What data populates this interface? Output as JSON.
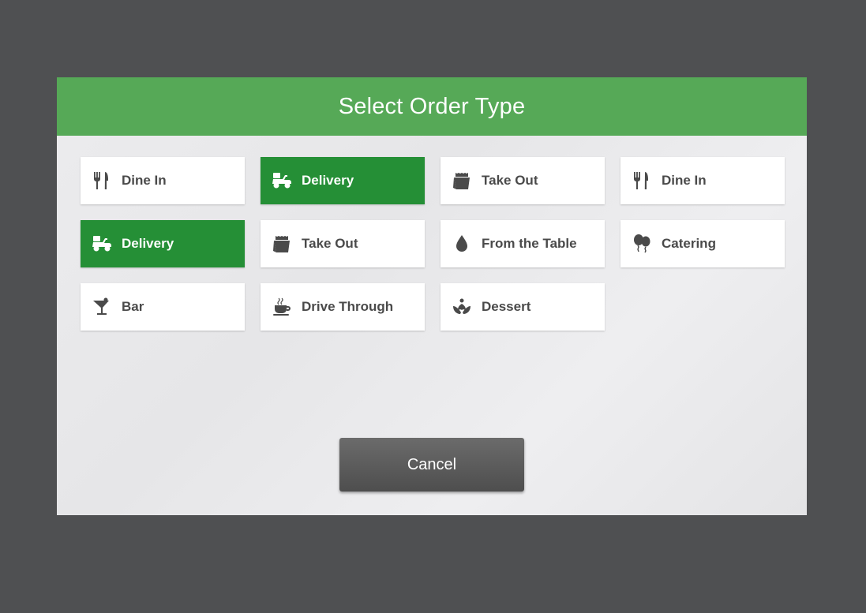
{
  "dialog": {
    "title": "Select Order Type",
    "colors": {
      "header": "#56a957",
      "selected_tile": "#258f36"
    }
  },
  "order_types": [
    {
      "label": "Dine In",
      "icon": "fork-knife-icon",
      "selected": false
    },
    {
      "label": "Delivery",
      "icon": "scooter-icon",
      "selected": true
    },
    {
      "label": "Take Out",
      "icon": "takeout-bag-icon",
      "selected": false
    },
    {
      "label": "Dine In",
      "icon": "fork-knife-icon",
      "selected": false
    },
    {
      "label": "Delivery",
      "icon": "scooter-icon",
      "selected": true
    },
    {
      "label": "Take Out",
      "icon": "takeout-bag-icon",
      "selected": false
    },
    {
      "label": "From the Table",
      "icon": "drop-icon",
      "selected": false
    },
    {
      "label": "Catering",
      "icon": "balloons-icon",
      "selected": false
    },
    {
      "label": "Bar",
      "icon": "cocktail-icon",
      "selected": false
    },
    {
      "label": "Drive Through",
      "icon": "coffee-cup-icon",
      "selected": false
    },
    {
      "label": "Dessert",
      "icon": "dessert-icon",
      "selected": false
    }
  ],
  "footer": {
    "cancel_label": "Cancel"
  }
}
